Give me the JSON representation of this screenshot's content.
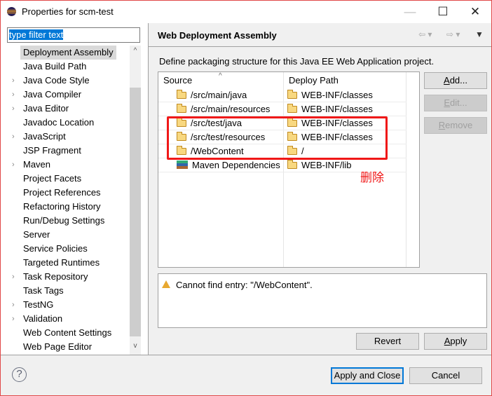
{
  "window": {
    "title": "Properties for scm-test"
  },
  "filter": {
    "value": "type filter text"
  },
  "tree": {
    "items": [
      {
        "label": "Deployment Assembly",
        "expandable": false,
        "selected": true
      },
      {
        "label": "Java Build Path",
        "expandable": false
      },
      {
        "label": "Java Code Style",
        "expandable": true
      },
      {
        "label": "Java Compiler",
        "expandable": true
      },
      {
        "label": "Java Editor",
        "expandable": true
      },
      {
        "label": "Javadoc Location",
        "expandable": false
      },
      {
        "label": "JavaScript",
        "expandable": true
      },
      {
        "label": "JSP Fragment",
        "expandable": false
      },
      {
        "label": "Maven",
        "expandable": true
      },
      {
        "label": "Project Facets",
        "expandable": false
      },
      {
        "label": "Project References",
        "expandable": false
      },
      {
        "label": "Refactoring History",
        "expandable": false
      },
      {
        "label": "Run/Debug Settings",
        "expandable": false
      },
      {
        "label": "Server",
        "expandable": false
      },
      {
        "label": "Service Policies",
        "expandable": false
      },
      {
        "label": "Targeted Runtimes",
        "expandable": false
      },
      {
        "label": "Task Repository",
        "expandable": true
      },
      {
        "label": "Task Tags",
        "expandable": false
      },
      {
        "label": "TestNG",
        "expandable": true
      },
      {
        "label": "Validation",
        "expandable": true
      },
      {
        "label": "Web Content Settings",
        "expandable": false
      },
      {
        "label": "Web Page Editor",
        "expandable": false
      }
    ]
  },
  "page": {
    "title": "Web Deployment Assembly",
    "description": "Define packaging structure for this Java EE Web Application project."
  },
  "table": {
    "columns": [
      "Source",
      "Deploy Path"
    ],
    "rows": [
      {
        "source": "/src/main/java",
        "path": "WEB-INF/classes",
        "icon": "folder-icon"
      },
      {
        "source": "/src/main/resources",
        "path": "WEB-INF/classes",
        "icon": "folder-icon"
      },
      {
        "source": "/src/test/java",
        "path": "WEB-INF/classes",
        "icon": "folder-icon"
      },
      {
        "source": "/src/test/resources",
        "path": "WEB-INF/classes",
        "icon": "folder-icon"
      },
      {
        "source": "/WebContent",
        "path": "/",
        "icon": "folder-icon"
      },
      {
        "source": "Maven Dependencies",
        "path": "WEB-INF/lib",
        "icon": "maven-library-icon"
      }
    ]
  },
  "buttons": {
    "add": "Add...",
    "edit": "Edit...",
    "remove": "Remove",
    "revert": "Revert",
    "apply": "Apply",
    "apply_close": "Apply and Close",
    "cancel": "Cancel"
  },
  "message": "Cannot find entry: \"/WebContent\".",
  "annotation": {
    "text": "删除",
    "color": "#f01818"
  }
}
